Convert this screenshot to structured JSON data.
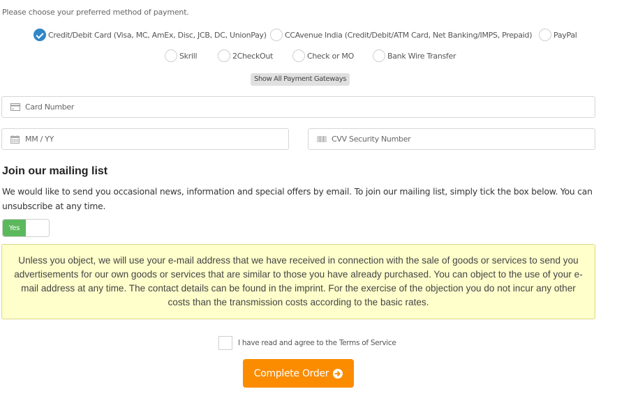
{
  "payment": {
    "intro": "Please choose your preferred method of payment.",
    "methods": [
      {
        "label": "Credit/Debit Card (Visa, MC, AmEx, Disc, JCB, DC, UnionPay)",
        "selected": true
      },
      {
        "label": "CCAvenue India (Credit/Debit/ATM Card, Net Banking/IMPS, Prepaid)",
        "selected": false
      },
      {
        "label": "PayPal",
        "selected": false
      },
      {
        "label": "Skrill",
        "selected": false
      },
      {
        "label": "2CheckOut",
        "selected": false
      },
      {
        "label": "Check or MO",
        "selected": false
      },
      {
        "label": "Bank Wire Transfer",
        "selected": false
      }
    ],
    "show_all_label": "Show All Payment Gateways"
  },
  "card_form": {
    "card_number": {
      "placeholder": "Card Number",
      "value": "",
      "icon": "credit-card-icon"
    },
    "expiry": {
      "placeholder": "MM / YY",
      "value": "",
      "icon": "calendar-icon"
    },
    "cvv": {
      "placeholder": "CVV Security Number",
      "value": "",
      "icon": "barcode-icon"
    }
  },
  "mailing": {
    "heading": "Join our mailing list",
    "description": "We would like to send you occasional news, information and special offers by email. To join our mailing list, simply tick the box below. You can unsubscribe at any time.",
    "toggle_label": "Yes",
    "toggle_on": true,
    "notice": "Unless you object, we will use your e-mail address that we have received in connection with the sale of goods or services to send you advertisements for our own goods or services that are similar to those you have already purchased. You can object to the use of your e-mail address at any time. The contact details can be found in the imprint. For the exercise of the objection you do not incur any other costs than the transmission costs according to the basic rates."
  },
  "terms": {
    "prefix": "I have read and agree to the ",
    "link_text": "Terms of Service",
    "checked": false
  },
  "submit": {
    "label": "Complete Order",
    "icon": "arrow-circle-right-icon",
    "color": "#fb8c00"
  },
  "colors": {
    "radio_selected": "#2f86c8",
    "toggle_on": "#5cb85c",
    "notice_bg": "#ffffcc"
  }
}
